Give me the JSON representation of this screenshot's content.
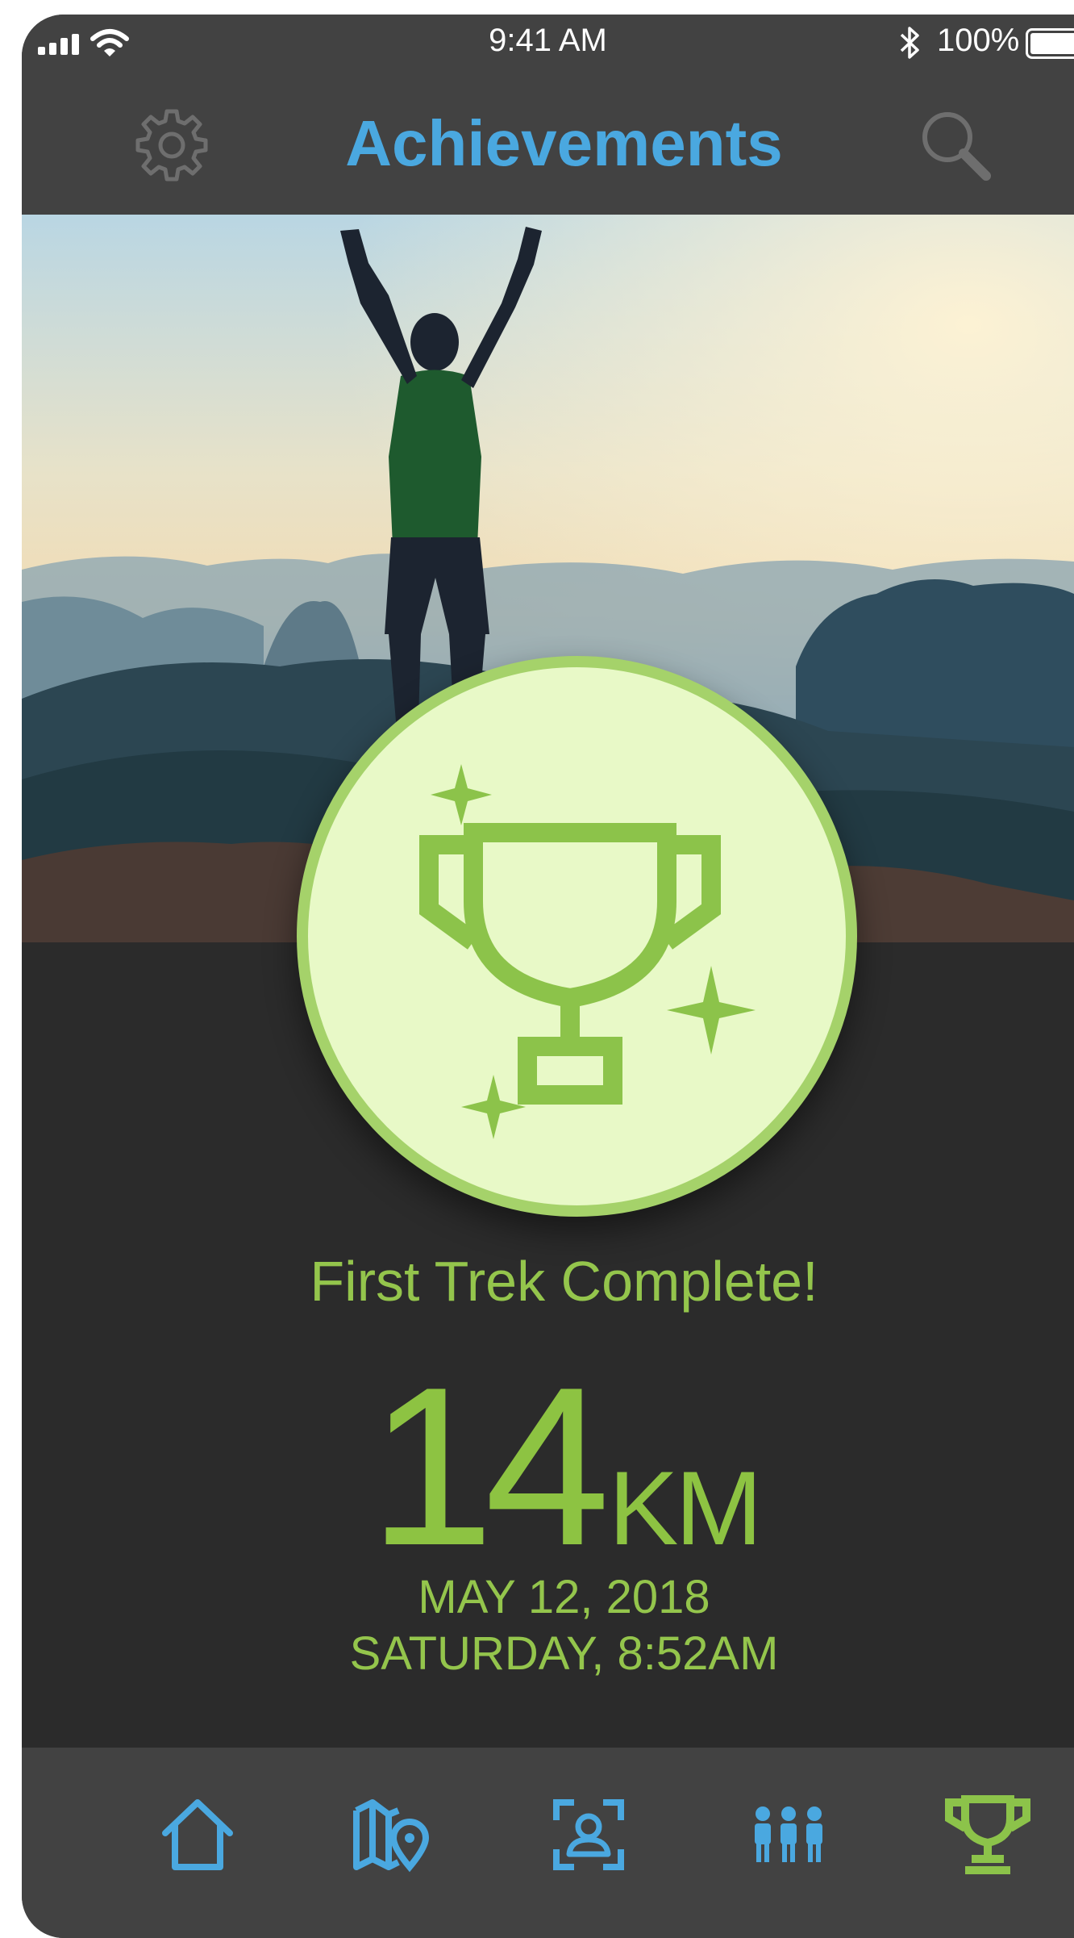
{
  "status_bar": {
    "time": "9:41 AM",
    "battery_text": "100%",
    "battery_level": 1.0,
    "icons": [
      "signal-bars-icon",
      "wifi-icon",
      "bluetooth-icon",
      "battery-icon"
    ]
  },
  "nav": {
    "title": "Achievements",
    "left_icon": "gear-icon",
    "right_icon": "search-icon",
    "accent_color": "#4aa8e0"
  },
  "hero": {
    "image": "photo of hiker with raised arms on mountain summit at sunrise"
  },
  "achievement": {
    "badge_icon": "trophy-icon",
    "badge_colors": {
      "fill": "#e8f9c7",
      "ring": "#a5d26a",
      "icon": "#8cc34a"
    },
    "title": "First Trek Complete!",
    "distance_value": "14",
    "distance_unit": "KM",
    "date": "MAY 12, 2018",
    "day_time": "SATURDAY, 8:52AM",
    "text_color": "#8dc342"
  },
  "tab_bar": {
    "items": [
      {
        "icon": "home-icon",
        "active": false
      },
      {
        "icon": "map-pin-icon",
        "active": false
      },
      {
        "icon": "profile-scan-icon",
        "active": false
      },
      {
        "icon": "people-group-icon",
        "active": false
      },
      {
        "icon": "trophy-icon",
        "active": true
      }
    ],
    "inactive_color": "#4aa8e0",
    "active_color": "#8cc34a"
  }
}
